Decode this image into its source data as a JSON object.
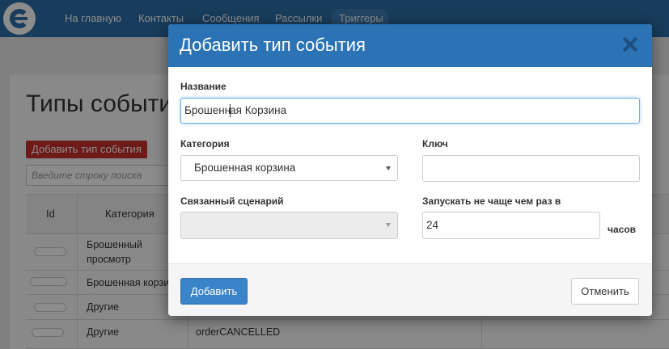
{
  "navbar": {
    "items": [
      "На главную",
      "Контакты",
      "Сообщения",
      "Рассылки",
      "Триггеры"
    ],
    "active": "Триггеры"
  },
  "page": {
    "title": "Типы событий",
    "add_button": "Добавить тип события",
    "search_placeholder": "Введите строку поиска",
    "table": {
      "headers": [
        "Id",
        "Категория"
      ],
      "rows": [
        {
          "category": "Брошенный просмотр",
          "category_lines": [
            "Брошенный",
            "просмотр"
          ],
          "key": ""
        },
        {
          "category": "Брошенная корзина",
          "category_display": "Брошенная корзи",
          "key": ""
        },
        {
          "category": "Другие",
          "key": ""
        },
        {
          "category": "Другие",
          "key": "orderCANCELLED"
        }
      ]
    }
  },
  "modal": {
    "title": "Добавить тип события",
    "fields": {
      "name_label": "Название",
      "name_value_before_caret": "Брошенн",
      "name_value_after_caret": "ая Корзина",
      "category_label": "Категория",
      "category_value": "Брошенная корзина",
      "key_label": "Ключ",
      "key_value": "",
      "scenario_label": "Связанный сценарий",
      "scenario_value": "",
      "frequency_label": "Запускать не чаще чем раз в",
      "frequency_value": "24",
      "frequency_unit": "часов"
    },
    "buttons": {
      "submit": "Добавить",
      "cancel": "Отменить"
    }
  },
  "colors": {
    "navbar": "#2d6ea8",
    "modal_header": "#2b73b5",
    "primary_button": "#3a84c9",
    "danger_button": "#c9302c"
  }
}
